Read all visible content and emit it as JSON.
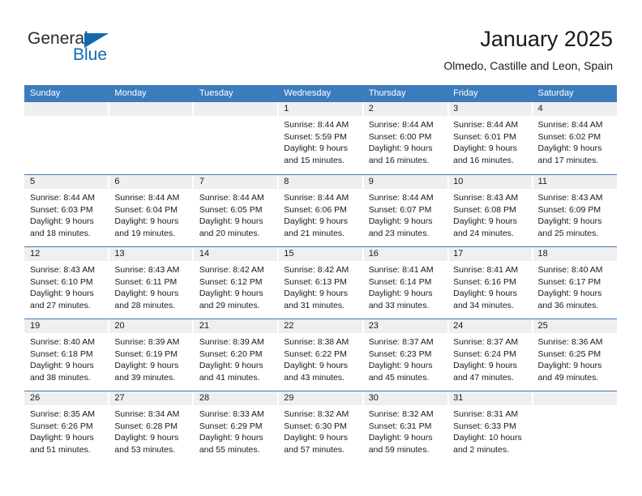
{
  "brand": {
    "name_part1": "General",
    "name_part2": "Blue",
    "accent_color": "#1269b0"
  },
  "header": {
    "title": "January 2025",
    "subtitle": "Olmedo, Castille and Leon, Spain"
  },
  "calendar": {
    "header_bg": "#3b7cbd",
    "band_bg": "#efefef",
    "day_names": [
      "Sunday",
      "Monday",
      "Tuesday",
      "Wednesday",
      "Thursday",
      "Friday",
      "Saturday"
    ],
    "weeks": [
      [
        {
          "day": "",
          "lines": []
        },
        {
          "day": "",
          "lines": []
        },
        {
          "day": "",
          "lines": []
        },
        {
          "day": "1",
          "lines": [
            "Sunrise: 8:44 AM",
            "Sunset: 5:59 PM",
            "Daylight: 9 hours",
            "and 15 minutes."
          ]
        },
        {
          "day": "2",
          "lines": [
            "Sunrise: 8:44 AM",
            "Sunset: 6:00 PM",
            "Daylight: 9 hours",
            "and 16 minutes."
          ]
        },
        {
          "day": "3",
          "lines": [
            "Sunrise: 8:44 AM",
            "Sunset: 6:01 PM",
            "Daylight: 9 hours",
            "and 16 minutes."
          ]
        },
        {
          "day": "4",
          "lines": [
            "Sunrise: 8:44 AM",
            "Sunset: 6:02 PM",
            "Daylight: 9 hours",
            "and 17 minutes."
          ]
        }
      ],
      [
        {
          "day": "5",
          "lines": [
            "Sunrise: 8:44 AM",
            "Sunset: 6:03 PM",
            "Daylight: 9 hours",
            "and 18 minutes."
          ]
        },
        {
          "day": "6",
          "lines": [
            "Sunrise: 8:44 AM",
            "Sunset: 6:04 PM",
            "Daylight: 9 hours",
            "and 19 minutes."
          ]
        },
        {
          "day": "7",
          "lines": [
            "Sunrise: 8:44 AM",
            "Sunset: 6:05 PM",
            "Daylight: 9 hours",
            "and 20 minutes."
          ]
        },
        {
          "day": "8",
          "lines": [
            "Sunrise: 8:44 AM",
            "Sunset: 6:06 PM",
            "Daylight: 9 hours",
            "and 21 minutes."
          ]
        },
        {
          "day": "9",
          "lines": [
            "Sunrise: 8:44 AM",
            "Sunset: 6:07 PM",
            "Daylight: 9 hours",
            "and 23 minutes."
          ]
        },
        {
          "day": "10",
          "lines": [
            "Sunrise: 8:43 AM",
            "Sunset: 6:08 PM",
            "Daylight: 9 hours",
            "and 24 minutes."
          ]
        },
        {
          "day": "11",
          "lines": [
            "Sunrise: 8:43 AM",
            "Sunset: 6:09 PM",
            "Daylight: 9 hours",
            "and 25 minutes."
          ]
        }
      ],
      [
        {
          "day": "12",
          "lines": [
            "Sunrise: 8:43 AM",
            "Sunset: 6:10 PM",
            "Daylight: 9 hours",
            "and 27 minutes."
          ]
        },
        {
          "day": "13",
          "lines": [
            "Sunrise: 8:43 AM",
            "Sunset: 6:11 PM",
            "Daylight: 9 hours",
            "and 28 minutes."
          ]
        },
        {
          "day": "14",
          "lines": [
            "Sunrise: 8:42 AM",
            "Sunset: 6:12 PM",
            "Daylight: 9 hours",
            "and 29 minutes."
          ]
        },
        {
          "day": "15",
          "lines": [
            "Sunrise: 8:42 AM",
            "Sunset: 6:13 PM",
            "Daylight: 9 hours",
            "and 31 minutes."
          ]
        },
        {
          "day": "16",
          "lines": [
            "Sunrise: 8:41 AM",
            "Sunset: 6:14 PM",
            "Daylight: 9 hours",
            "and 33 minutes."
          ]
        },
        {
          "day": "17",
          "lines": [
            "Sunrise: 8:41 AM",
            "Sunset: 6:16 PM",
            "Daylight: 9 hours",
            "and 34 minutes."
          ]
        },
        {
          "day": "18",
          "lines": [
            "Sunrise: 8:40 AM",
            "Sunset: 6:17 PM",
            "Daylight: 9 hours",
            "and 36 minutes."
          ]
        }
      ],
      [
        {
          "day": "19",
          "lines": [
            "Sunrise: 8:40 AM",
            "Sunset: 6:18 PM",
            "Daylight: 9 hours",
            "and 38 minutes."
          ]
        },
        {
          "day": "20",
          "lines": [
            "Sunrise: 8:39 AM",
            "Sunset: 6:19 PM",
            "Daylight: 9 hours",
            "and 39 minutes."
          ]
        },
        {
          "day": "21",
          "lines": [
            "Sunrise: 8:39 AM",
            "Sunset: 6:20 PM",
            "Daylight: 9 hours",
            "and 41 minutes."
          ]
        },
        {
          "day": "22",
          "lines": [
            "Sunrise: 8:38 AM",
            "Sunset: 6:22 PM",
            "Daylight: 9 hours",
            "and 43 minutes."
          ]
        },
        {
          "day": "23",
          "lines": [
            "Sunrise: 8:37 AM",
            "Sunset: 6:23 PM",
            "Daylight: 9 hours",
            "and 45 minutes."
          ]
        },
        {
          "day": "24",
          "lines": [
            "Sunrise: 8:37 AM",
            "Sunset: 6:24 PM",
            "Daylight: 9 hours",
            "and 47 minutes."
          ]
        },
        {
          "day": "25",
          "lines": [
            "Sunrise: 8:36 AM",
            "Sunset: 6:25 PM",
            "Daylight: 9 hours",
            "and 49 minutes."
          ]
        }
      ],
      [
        {
          "day": "26",
          "lines": [
            "Sunrise: 8:35 AM",
            "Sunset: 6:26 PM",
            "Daylight: 9 hours",
            "and 51 minutes."
          ]
        },
        {
          "day": "27",
          "lines": [
            "Sunrise: 8:34 AM",
            "Sunset: 6:28 PM",
            "Daylight: 9 hours",
            "and 53 minutes."
          ]
        },
        {
          "day": "28",
          "lines": [
            "Sunrise: 8:33 AM",
            "Sunset: 6:29 PM",
            "Daylight: 9 hours",
            "and 55 minutes."
          ]
        },
        {
          "day": "29",
          "lines": [
            "Sunrise: 8:32 AM",
            "Sunset: 6:30 PM",
            "Daylight: 9 hours",
            "and 57 minutes."
          ]
        },
        {
          "day": "30",
          "lines": [
            "Sunrise: 8:32 AM",
            "Sunset: 6:31 PM",
            "Daylight: 9 hours",
            "and 59 minutes."
          ]
        },
        {
          "day": "31",
          "lines": [
            "Sunrise: 8:31 AM",
            "Sunset: 6:33 PM",
            "Daylight: 10 hours",
            "and 2 minutes."
          ]
        },
        {
          "day": "",
          "lines": []
        }
      ]
    ]
  }
}
